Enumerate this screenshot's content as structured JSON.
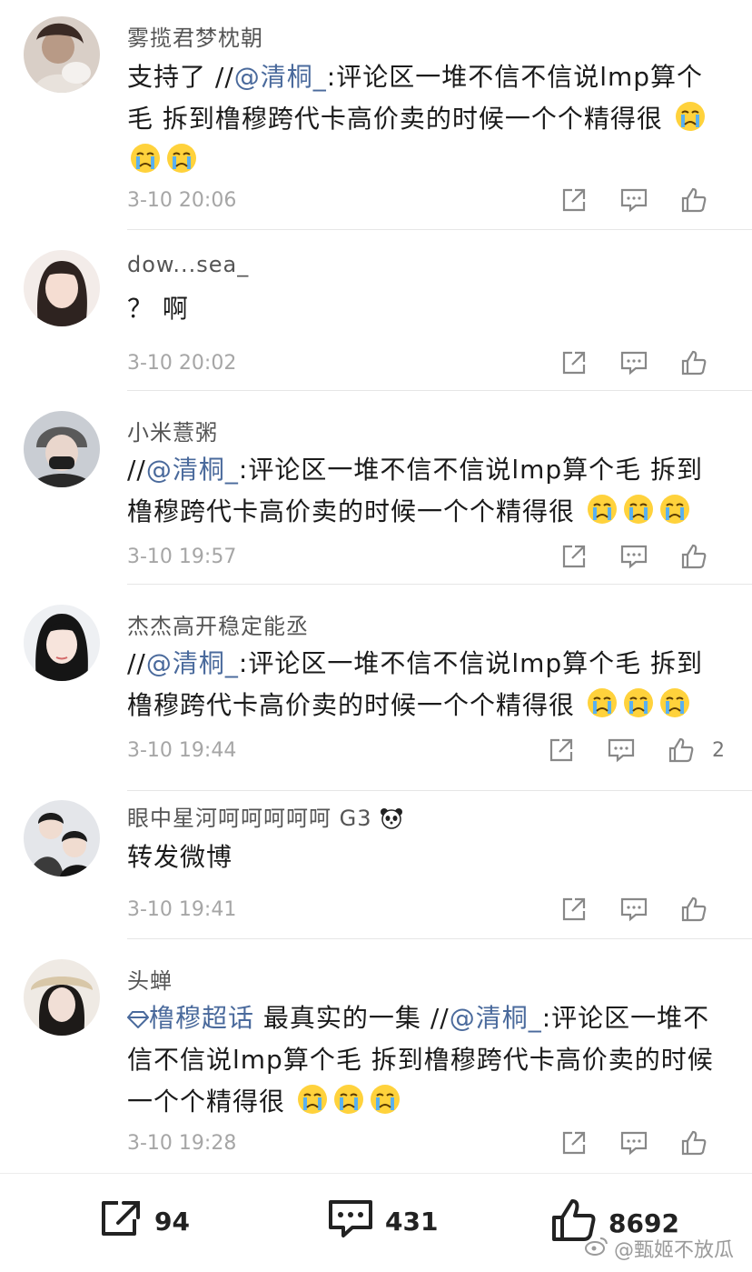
{
  "comments": [
    {
      "username": "雾揽君梦枕朝",
      "text_plain": "支持了 //",
      "mention": "@清桐_",
      "text_after": ":评论区一堆不信不信说lmp算个毛 拆到橹穆跨代卡高价卖的时候一个个精得很",
      "time": "3-10 20:06",
      "likes": ""
    },
    {
      "username": "dow...sea_",
      "text_plain": "？ 啊",
      "time": "3-10 20:02",
      "likes": ""
    },
    {
      "username": "小米薏粥",
      "text_plain": "//",
      "mention": "@清桐_",
      "text_after": ":评论区一堆不信不信说lmp算个毛 拆到橹穆跨代卡高价卖的时候一个个精得很",
      "time": "3-10 19:57",
      "likes": ""
    },
    {
      "username": "杰杰高开稳定能丞",
      "text_plain": "//",
      "mention": "@清桐_",
      "text_after": ":评论区一堆不信不信说lmp算个毛 拆到橹穆跨代卡高价卖的时候一个个精得很",
      "time": "3-10 19:44",
      "likes": "2"
    },
    {
      "username": "眼中星河呵呵呵呵呵 G3",
      "text_plain": "转发微博",
      "time": "3-10 19:41",
      "likes": ""
    },
    {
      "username": "头蝉",
      "topic": "橹穆超话",
      "text_plain": " 最真实的一集 //",
      "mention": "@清桐_",
      "text_after": ":评论区一堆不信不信说lmp算个毛 拆到橹穆跨代卡高价卖的时候一个个精得很",
      "time": "3-10 19:28",
      "likes": ""
    }
  ],
  "bottom_bar": {
    "repost_count": "94",
    "comment_count": "431",
    "like_count": "8692"
  },
  "watermark": "@甄姬不放瓜",
  "colors": {
    "link": "#4a6a9c",
    "time": "#a6a6a6",
    "divider": "#e6e6e6"
  }
}
